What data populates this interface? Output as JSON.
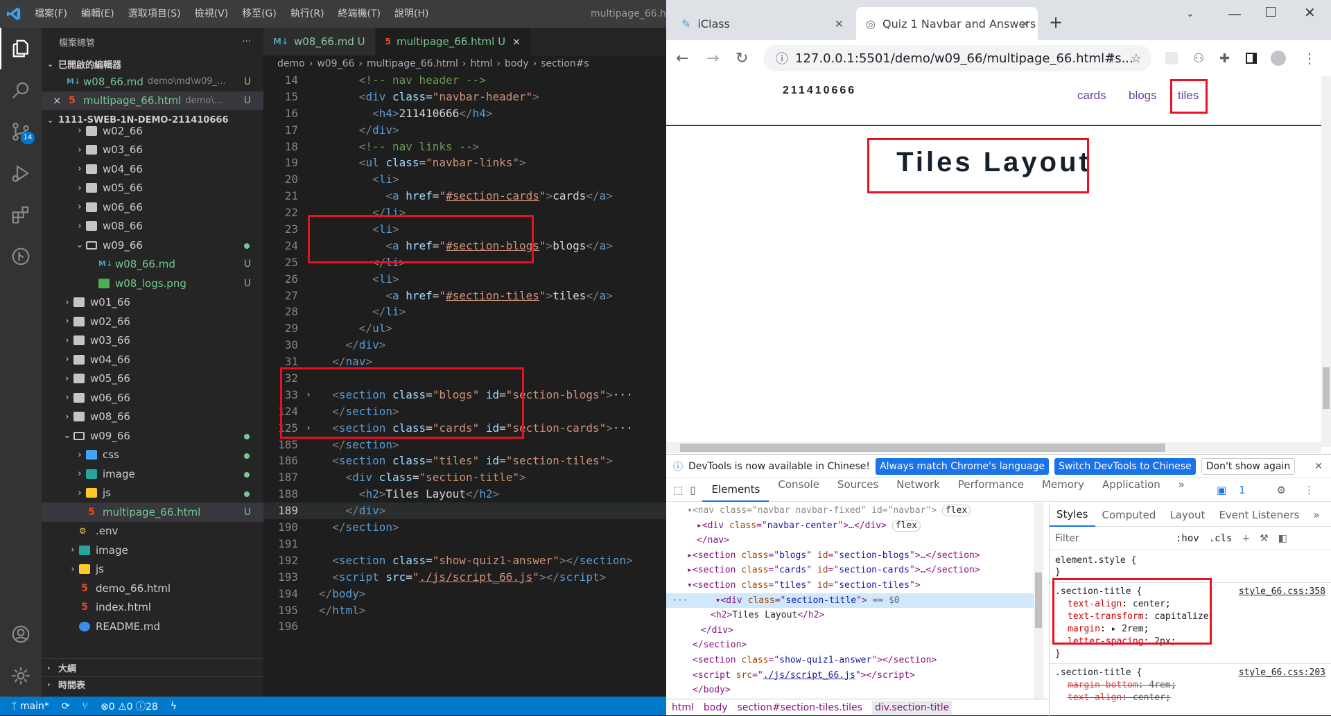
{
  "vscode": {
    "menu": [
      "檔案(F)",
      "編輯(E)",
      "選取項目(S)",
      "檢視(V)",
      "移至(G)",
      "執行(R)",
      "終端機(T)",
      "說明(H)"
    ],
    "title": "multipage_66.ht",
    "explorer_title": "檔案總管",
    "open_editors": "已開啟的編輯器",
    "open_files": [
      {
        "name": "w08_66.md",
        "desc": "demo\\md\\w09_...",
        "status": "U"
      },
      {
        "name": "multipage_66.html",
        "desc": "demo\\...",
        "status": "U"
      }
    ],
    "workspace": "1111-SWEB-1N-DEMO-211410666",
    "tree": [
      {
        "label": "w02_66",
        "depth": 1,
        "kind": "folder",
        "chev": "›"
      },
      {
        "label": "w03_66",
        "depth": 1,
        "kind": "folder",
        "chev": "›"
      },
      {
        "label": "w04_66",
        "depth": 1,
        "kind": "folder",
        "chev": "›"
      },
      {
        "label": "w05_66",
        "depth": 1,
        "kind": "folder",
        "chev": "›"
      },
      {
        "label": "w06_66",
        "depth": 1,
        "kind": "folder",
        "chev": "›"
      },
      {
        "label": "w08_66",
        "depth": 1,
        "kind": "folder",
        "chev": "›"
      },
      {
        "label": "w09_66",
        "depth": 1,
        "kind": "folder-open",
        "chev": "⌄",
        "dot": true
      },
      {
        "label": "w08_66.md",
        "depth": 2,
        "kind": "md",
        "status": "U"
      },
      {
        "label": "w08_logs.png",
        "depth": 2,
        "kind": "png",
        "status": "U"
      },
      {
        "label": "w01_66",
        "depth": 0,
        "kind": "folder",
        "chev": "›"
      },
      {
        "label": "w02_66",
        "depth": 0,
        "kind": "folder",
        "chev": "›"
      },
      {
        "label": "w03_66",
        "depth": 0,
        "kind": "folder",
        "chev": "›"
      },
      {
        "label": "w04_66",
        "depth": 0,
        "kind": "folder",
        "chev": "›"
      },
      {
        "label": "w05_66",
        "depth": 0,
        "kind": "folder",
        "chev": "›"
      },
      {
        "label": "w06_66",
        "depth": 0,
        "kind": "folder",
        "chev": "›"
      },
      {
        "label": "w08_66",
        "depth": 0,
        "kind": "folder",
        "chev": "›"
      },
      {
        "label": "w09_66",
        "depth": 0,
        "kind": "folder-open",
        "chev": "⌄",
        "dot": true
      },
      {
        "label": "css",
        "depth": 1,
        "kind": "css",
        "chev": "›",
        "dot": true
      },
      {
        "label": "image",
        "depth": 1,
        "kind": "img",
        "chev": "›",
        "dot": true
      },
      {
        "label": "js",
        "depth": 1,
        "kind": "js",
        "chev": "›",
        "dot": true
      },
      {
        "label": "multipage_66.html",
        "depth": 1,
        "kind": "html",
        "status": "U",
        "sel": true
      },
      {
        "label": ".env",
        "depth": -1,
        "kind": "env"
      },
      {
        "label": "image",
        "depth": -1,
        "kind": "img",
        "chev": "›"
      },
      {
        "label": "js",
        "depth": -1,
        "kind": "js",
        "chev": "›"
      },
      {
        "label": "demo_66.html",
        "depth": -1,
        "kind": "html"
      },
      {
        "label": "index.html",
        "depth": -1,
        "kind": "html"
      },
      {
        "label": "README.md",
        "depth": -1,
        "kind": "info"
      }
    ],
    "outline": "大綱",
    "timeline": "時間表",
    "tabs": [
      {
        "name": "w08_66.md",
        "status": "U"
      },
      {
        "name": "multipage_66.html",
        "status": "U"
      }
    ],
    "breadcrumb": [
      "demo",
      "›",
      "w09_66",
      "›",
      "multipage_66.html",
      "›",
      "html",
      "›",
      "body",
      "›",
      "section#s"
    ],
    "code": [
      {
        "n": "14",
        "h": "      <span class=t-cm>&lt;!-- nav header --&gt;</span>"
      },
      {
        "n": "15",
        "h": "      <span class=t-br>&lt;</span><span class=t-tag>div</span> <span class=t-attr>class</span>=<span class=t-str>\"navbar-header\"</span><span class=t-br>&gt;</span>"
      },
      {
        "n": "16",
        "h": "        <span class=t-br>&lt;</span><span class=t-tag>h4</span><span class=t-br>&gt;</span>211410666<span class=t-br>&lt;/</span><span class=t-tag>h4</span><span class=t-br>&gt;</span>"
      },
      {
        "n": "17",
        "h": "      <span class=t-br>&lt;/</span><span class=t-tag>div</span><span class=t-br>&gt;</span>"
      },
      {
        "n": "18",
        "h": "      <span class=t-cm>&lt;!-- nav links --&gt;</span>"
      },
      {
        "n": "19",
        "h": "      <span class=t-br>&lt;</span><span class=t-tag>ul</span> <span class=t-attr>class</span>=<span class=t-str>\"navbar-links\"</span><span class=t-br>&gt;</span>"
      },
      {
        "n": "20",
        "h": "        <span class=t-br>&lt;</span><span class=t-tag>li</span><span class=t-br>&gt;</span>"
      },
      {
        "n": "21",
        "h": "          <span class=t-br>&lt;</span><span class=t-tag>a</span> <span class=t-attr>href</span>=<span class=t-str>\"<u>#section-cards</u>\"</span><span class=t-br>&gt;</span>cards<span class=t-br>&lt;/</span><span class=t-tag>a</span><span class=t-br>&gt;</span>"
      },
      {
        "n": "22",
        "h": "        <span class=t-br>&lt;/</span><span class=t-tag>li</span><span class=t-br>&gt;</span>"
      },
      {
        "n": "23",
        "h": "        <span class=t-br>&lt;</span><span class=t-tag>li</span><span class=t-br>&gt;</span>"
      },
      {
        "n": "24",
        "h": "          <span class=t-br>&lt;</span><span class=t-tag>a</span> <span class=t-attr>href</span>=<span class=t-str>\"<u>#section-blogs</u>\"</span><span class=t-br>&gt;</span>blogs<span class=t-br>&lt;/</span><span class=t-tag>a</span><span class=t-br>&gt;</span>"
      },
      {
        "n": "25",
        "h": "        <span class=t-br>&lt;/</span><span class=t-tag>li</span><span class=t-br>&gt;</span>"
      },
      {
        "n": "26",
        "h": "        <span class=t-br>&lt;</span><span class=t-tag>li</span><span class=t-br>&gt;</span>"
      },
      {
        "n": "27",
        "h": "          <span class=t-br>&lt;</span><span class=t-tag>a</span> <span class=t-attr>href</span>=<span class=t-str>\"<u>#section-tiles</u>\"</span><span class=t-br>&gt;</span>tiles<span class=t-br>&lt;/</span><span class=t-tag>a</span><span class=t-br>&gt;</span>"
      },
      {
        "n": "28",
        "h": "        <span class=t-br>&lt;/</span><span class=t-tag>li</span><span class=t-br>&gt;</span>"
      },
      {
        "n": "29",
        "h": "      <span class=t-br>&lt;/</span><span class=t-tag>ul</span><span class=t-br>&gt;</span>"
      },
      {
        "n": "30",
        "h": "    <span class=t-br>&lt;/</span><span class=t-tag>div</span><span class=t-br>&gt;</span>"
      },
      {
        "n": "31",
        "h": "  <span class=t-br>&lt;/</span><span class=t-tag>nav</span><span class=t-br>&gt;</span>"
      },
      {
        "n": "32",
        "h": ""
      },
      {
        "n": "33",
        "f": "›",
        "h": "  <span class=t-br>&lt;</span><span class=t-tag>section</span> <span class=t-attr>class</span>=<span class=t-str>\"blogs\"</span> <span class=t-attr>id</span>=<span class=t-str>\"section-blogs\"</span><span class=t-br>&gt;</span><span class=t-txt>···</span>"
      },
      {
        "n": "124",
        "h": "  <span class=t-br>&lt;/</span><span class=t-tag>section</span><span class=t-br>&gt;</span>"
      },
      {
        "n": "125",
        "f": "›",
        "h": "  <span class=t-br>&lt;</span><span class=t-tag>section</span> <span class=t-attr>class</span>=<span class=t-str>\"cards\"</span> <span class=t-attr>id</span>=<span class=t-str>\"section-cards\"</span><span class=t-br>&gt;</span><span class=t-txt>···</span>"
      },
      {
        "n": "185",
        "h": "  <span class=t-br>&lt;/</span><span class=t-tag>section</span><span class=t-br>&gt;</span>"
      },
      {
        "n": "186",
        "h": "  <span class=t-br>&lt;</span><span class=t-tag>section</span> <span class=t-attr>class</span>=<span class=t-str>\"tiles\"</span> <span class=t-attr>id</span>=<span class=t-str>\"section-tiles\"</span><span class=t-br>&gt;</span>"
      },
      {
        "n": "187",
        "h": "    <span class=t-br>&lt;</span><span class=t-tag>div</span> <span class=t-attr>class</span>=<span class=t-str>\"section-title\"</span><span class=t-br>&gt;</span>"
      },
      {
        "n": "188",
        "h": "      <span class=t-br>&lt;</span><span class=t-tag>h2</span><span class=t-br>&gt;</span>Tiles Layout<span class=t-br>&lt;/</span><span class=t-tag>h2</span><span class=t-br>&gt;</span>"
      },
      {
        "n": "189",
        "cur": true,
        "h": "    <span class=t-br>&lt;/</span><span class=t-tag>div</span><span class=t-br>&gt;</span>"
      },
      {
        "n": "190",
        "h": "  <span class=t-br>&lt;/</span><span class=t-tag>section</span><span class=t-br>&gt;</span>"
      },
      {
        "n": "191",
        "h": ""
      },
      {
        "n": "192",
        "h": "  <span class=t-br>&lt;</span><span class=t-tag>section</span> <span class=t-attr>class</span>=<span class=t-str>\"show-quiz1-answer\"</span><span class=t-br>&gt;&lt;/</span><span class=t-tag>section</span><span class=t-br>&gt;</span>"
      },
      {
        "n": "193",
        "h": "  <span class=t-br>&lt;</span><span class=t-tag>script</span> <span class=t-attr>src</span>=<span class=t-str>\"<u>./js/script_66.js</u>\"</span><span class=t-br>&gt;&lt;/</span><span class=t-tag>script</span><span class=t-br>&gt;</span>"
      },
      {
        "n": "194",
        "h": "<span class=t-br>&lt;/</span><span class=t-tag>body</span><span class=t-br>&gt;</span>"
      },
      {
        "n": "195",
        "h": "<span class=t-br>&lt;/</span><span class=t-tag>html</span><span class=t-br>&gt;</span>"
      },
      {
        "n": "196",
        "h": ""
      }
    ],
    "status": {
      "branch": "main*",
      "problems": "⊗0 ⚠0 ⓘ28"
    }
  },
  "chrome": {
    "tabs": [
      {
        "title": "iClass"
      },
      {
        "title": "Quiz 1 Navbar and Answers"
      }
    ],
    "url": "127.0.0.1:5501/demo/w09_66/multipage_66.html#s...",
    "page": {
      "brand": "211410666",
      "links": [
        "cards",
        "blogs",
        "tiles"
      ],
      "heading": "Tiles Layout"
    },
    "devtools": {
      "info": "DevTools is now available in Chinese!",
      "btn_match": "Always match Chrome's language",
      "btn_switch": "Switch DevTools to Chinese",
      "btn_dont": "Don't show again",
      "tabs": [
        "Elements",
        "Console",
        "Sources",
        "Network",
        "Performance",
        "Memory",
        "Application",
        "»"
      ],
      "issues": "1",
      "style_tabs": [
        "Styles",
        "Computed",
        "Layout",
        "Event Listeners",
        "»"
      ],
      "filter": "Filter",
      "hov": ":hov",
      "cls": ".cls",
      "element_style": "element.style {",
      "rule1_sel": ".section-title {",
      "rule1_src": "style_66.css:358",
      "rule1_props": [
        [
          "text-align",
          "center"
        ],
        [
          "text-transform",
          "capitalize"
        ],
        [
          "margin",
          "▸ 2rem"
        ],
        [
          "letter-spacing",
          "2px"
        ]
      ],
      "rule2_sel": ".section-title {",
      "rule2_src": "style_66.css:203",
      "rule2_props": [
        [
          "margin-bottom",
          "4rem"
        ],
        [
          "text-align",
          "center"
        ]
      ],
      "crumbs": [
        "html",
        "body",
        "section#section-tiles.tiles",
        "div.section-title"
      ]
    }
  }
}
